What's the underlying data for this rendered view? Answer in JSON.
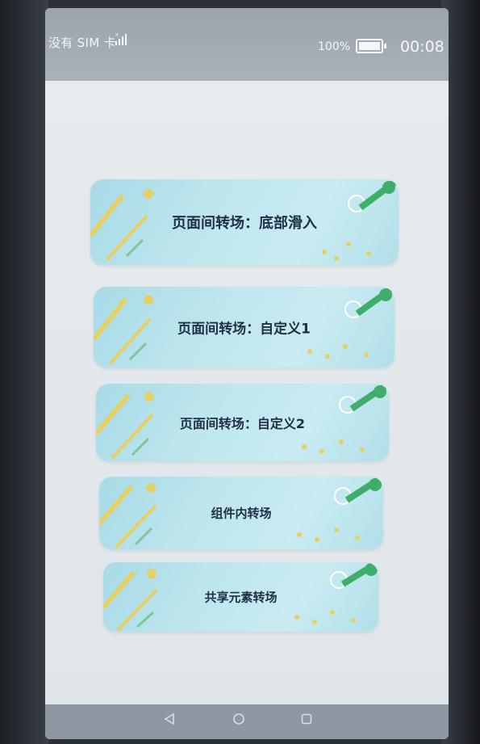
{
  "status_bar": {
    "carrier": "没有 SIM 卡",
    "battery_percent": "100%",
    "time": "00:08"
  },
  "buttons": [
    {
      "label": "页面间转场：底部滑入"
    },
    {
      "label": "页面间转场：自定义1"
    },
    {
      "label": "页面间转场：自定义2"
    },
    {
      "label": "组件内转场"
    },
    {
      "label": "共享元素转场"
    }
  ],
  "nav_bar": {
    "back_icon": "triangle-back-icon",
    "home_icon": "circle-home-icon",
    "recents_icon": "square-recents-icon"
  },
  "colors": {
    "card_base": "#bfe6ee",
    "card_accent_yellow": "#e6cf63",
    "card_accent_green": "#3fae6a",
    "label_text": "#1f2f45"
  }
}
